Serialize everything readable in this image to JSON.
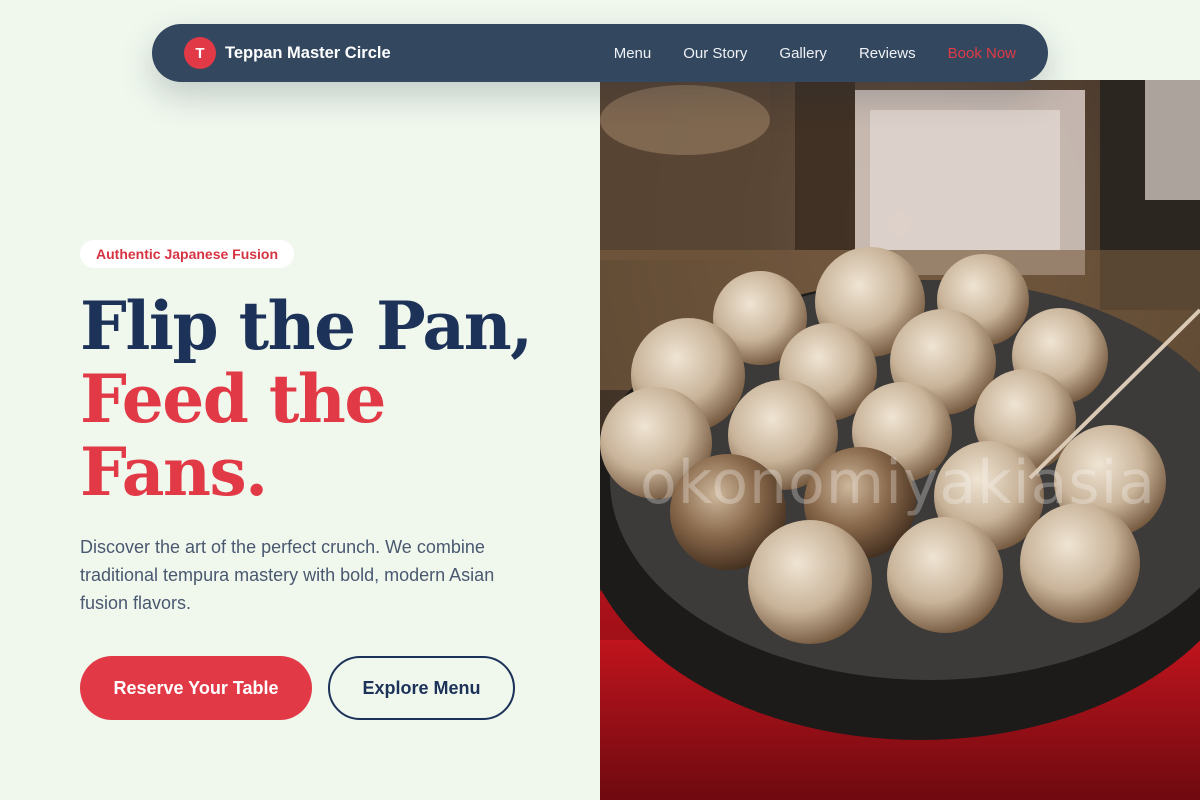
{
  "navbar": {
    "brand_initial": "T",
    "brand_name": "Teppan Master Circle",
    "links": [
      "Menu",
      "Our Story",
      "Gallery",
      "Reviews"
    ],
    "cta_label": "Book Now"
  },
  "hero": {
    "badge": "Authentic Japanese Fusion",
    "headline_line1": "Flip the Pan,",
    "headline_line2": "Feed the Fans.",
    "description": "Discover the art of the perfect crunch. We combine traditional tempura mastery with bold, modern Asian fusion flavors.",
    "primary_button": "Reserve Your Table",
    "secondary_button": "Explore Menu",
    "image_watermark": "okonomiyakiasia"
  },
  "colors": {
    "accent": "#e23946",
    "navy": "#1d3258",
    "navbar_bg": "#33475f",
    "page_bg": "#f0f8ee"
  }
}
